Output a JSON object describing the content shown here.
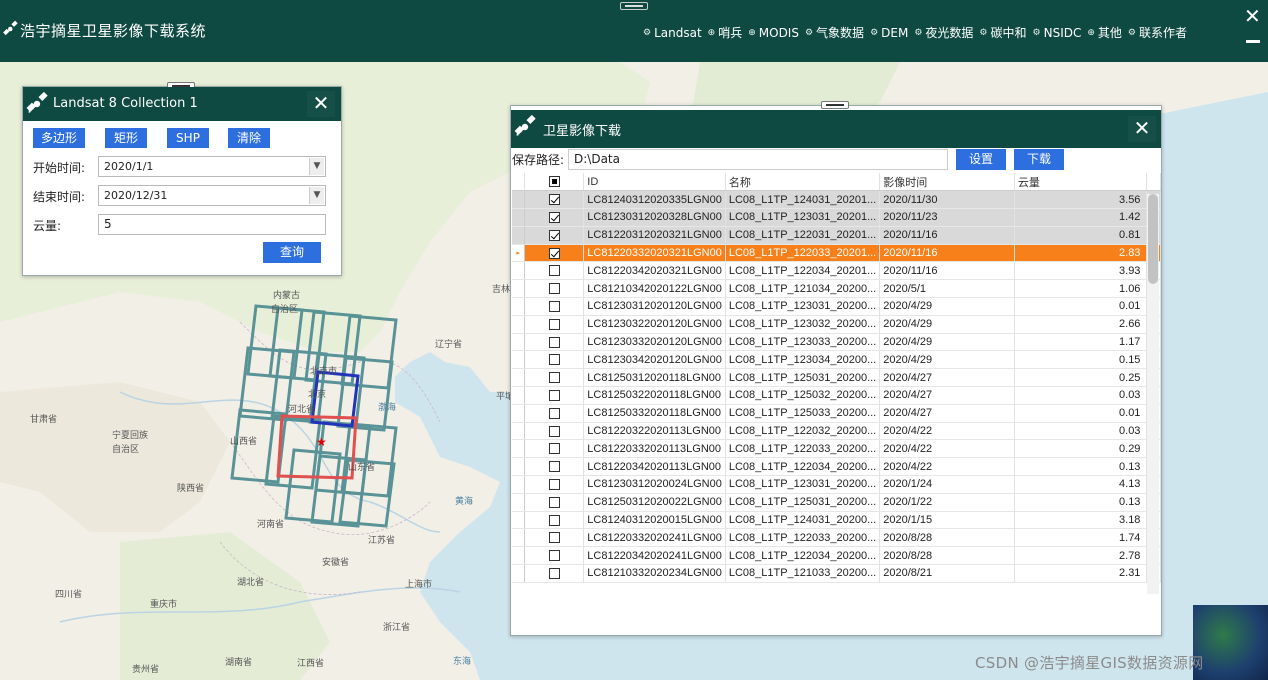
{
  "header": {
    "title": "浩宇摘星卫星影像下载系统",
    "nav": [
      {
        "label": "Landsat",
        "icon": "gear-icon"
      },
      {
        "label": "哨兵",
        "icon": "globe-icon"
      },
      {
        "label": "MODIS",
        "icon": "globe-icon"
      },
      {
        "label": "气象数据",
        "icon": "gear-icon"
      },
      {
        "label": "DEM",
        "icon": "gear-icon"
      },
      {
        "label": "夜光数据",
        "icon": "gear-icon"
      },
      {
        "label": "碳中和",
        "icon": "gear-icon"
      },
      {
        "label": "NSIDC",
        "icon": "gear-icon"
      },
      {
        "label": "其他",
        "icon": "globe-icon"
      },
      {
        "label": "联系作者",
        "icon": "gear-icon"
      }
    ]
  },
  "query": {
    "title": "Landsat 8 Collection 1",
    "buttons": [
      "多边形",
      "矩形",
      "SHP",
      "清除"
    ],
    "start_label": "开始时间:",
    "start_value": "2020/1/1",
    "end_label": "结束时间:",
    "end_value": "2020/12/31",
    "cloud_label": "云量:",
    "cloud_value": "5",
    "query_button": "查询"
  },
  "download": {
    "title": "卫星影像下载",
    "path_label": "保存路径:",
    "path_value": "D:\\Data",
    "set_button": "设置",
    "download_button": "下载",
    "columns": [
      "ID",
      "名称",
      "影像时间",
      "云量"
    ],
    "rows": [
      {
        "id": "LC81240312020335LGN00",
        "name": "LC08_L1TP_124031_20201...",
        "date": "2020/11/30",
        "cloud": "3.56",
        "checked": true,
        "state": "sel"
      },
      {
        "id": "LC81230312020328LGN00",
        "name": "LC08_L1TP_123031_20201...",
        "date": "2020/11/23",
        "cloud": "1.42",
        "checked": true,
        "state": "sel"
      },
      {
        "id": "LC81220312020321LGN00",
        "name": "LC08_L1TP_122031_20201...",
        "date": "2020/11/16",
        "cloud": "0.81",
        "checked": true,
        "state": "sel"
      },
      {
        "id": "LC81220332020321LGN00",
        "name": "LC08_L1TP_122033_20201...",
        "date": "2020/11/16",
        "cloud": "2.83",
        "checked": true,
        "state": "active"
      },
      {
        "id": "LC81220342020321LGN00",
        "name": "LC08_L1TP_122034_20201...",
        "date": "2020/11/16",
        "cloud": "3.93",
        "checked": false,
        "state": ""
      },
      {
        "id": "LC81210342020122LGN00",
        "name": "LC08_L1TP_121034_20200...",
        "date": "2020/5/1",
        "cloud": "1.06",
        "checked": false,
        "state": ""
      },
      {
        "id": "LC81230312020120LGN00",
        "name": "LC08_L1TP_123031_20200...",
        "date": "2020/4/29",
        "cloud": "0.01",
        "checked": false,
        "state": ""
      },
      {
        "id": "LC81230322020120LGN00",
        "name": "LC08_L1TP_123032_20200...",
        "date": "2020/4/29",
        "cloud": "2.66",
        "checked": false,
        "state": ""
      },
      {
        "id": "LC81230332020120LGN00",
        "name": "LC08_L1TP_123033_20200...",
        "date": "2020/4/29",
        "cloud": "1.17",
        "checked": false,
        "state": ""
      },
      {
        "id": "LC81230342020120LGN00",
        "name": "LC08_L1TP_123034_20200...",
        "date": "2020/4/29",
        "cloud": "0.15",
        "checked": false,
        "state": ""
      },
      {
        "id": "LC81250312020118LGN00",
        "name": "LC08_L1TP_125031_20200...",
        "date": "2020/4/27",
        "cloud": "0.25",
        "checked": false,
        "state": ""
      },
      {
        "id": "LC81250322020118LGN00",
        "name": "LC08_L1TP_125032_20200...",
        "date": "2020/4/27",
        "cloud": "0.03",
        "checked": false,
        "state": ""
      },
      {
        "id": "LC81250332020118LGN00",
        "name": "LC08_L1TP_125033_20200...",
        "date": "2020/4/27",
        "cloud": "0.01",
        "checked": false,
        "state": ""
      },
      {
        "id": "LC81220322020113LGN00",
        "name": "LC08_L1TP_122032_20200...",
        "date": "2020/4/22",
        "cloud": "0.03",
        "checked": false,
        "state": ""
      },
      {
        "id": "LC81220332020113LGN00",
        "name": "LC08_L1TP_122033_20200...",
        "date": "2020/4/22",
        "cloud": "0.29",
        "checked": false,
        "state": ""
      },
      {
        "id": "LC81220342020113LGN00",
        "name": "LC08_L1TP_122034_20200...",
        "date": "2020/4/22",
        "cloud": "0.13",
        "checked": false,
        "state": ""
      },
      {
        "id": "LC81230312020024LGN00",
        "name": "LC08_L1TP_123031_20200...",
        "date": "2020/1/24",
        "cloud": "4.13",
        "checked": false,
        "state": ""
      },
      {
        "id": "LC81250312020022LGN00",
        "name": "LC08_L1TP_125031_20200...",
        "date": "2020/1/22",
        "cloud": "0.13",
        "checked": false,
        "state": ""
      },
      {
        "id": "LC81240312020015LGN00",
        "name": "LC08_L1TP_124031_20200...",
        "date": "2020/1/15",
        "cloud": "3.18",
        "checked": false,
        "state": ""
      },
      {
        "id": "LC81220332020241LGN00",
        "name": "LC08_L1TP_122033_20200...",
        "date": "2020/8/28",
        "cloud": "1.74",
        "checked": false,
        "state": ""
      },
      {
        "id": "LC81220342020241LGN00",
        "name": "LC08_L1TP_122034_20200...",
        "date": "2020/8/28",
        "cloud": "2.78",
        "checked": false,
        "state": ""
      },
      {
        "id": "LC81210332020234LGN00",
        "name": "LC08_L1TP_121033_20200...",
        "date": "2020/8/21",
        "cloud": "2.31",
        "checked": false,
        "state": ""
      }
    ]
  },
  "map": {
    "labels": [
      {
        "text": "内蒙古",
        "cls": ""
      },
      {
        "text": "自治区",
        "cls": ""
      },
      {
        "text": "吉林",
        "cls": ""
      },
      {
        "text": "辽宁省",
        "cls": ""
      },
      {
        "text": "北京市",
        "cls": ""
      },
      {
        "text": "北京",
        "cls": ""
      },
      {
        "text": "河北省",
        "cls": ""
      },
      {
        "text": "渤海",
        "cls": "sea"
      },
      {
        "text": "平壤",
        "cls": ""
      },
      {
        "text": "甘肃省",
        "cls": ""
      },
      {
        "text": "宁夏回族",
        "cls": ""
      },
      {
        "text": "自治区",
        "cls": ""
      },
      {
        "text": "山西省",
        "cls": ""
      },
      {
        "text": "山东省",
        "cls": ""
      },
      {
        "text": "陕西省",
        "cls": ""
      },
      {
        "text": "黄海",
        "cls": "sea"
      },
      {
        "text": "河南省",
        "cls": ""
      },
      {
        "text": "江苏省",
        "cls": ""
      },
      {
        "text": "安徽省",
        "cls": ""
      },
      {
        "text": "湖北省",
        "cls": ""
      },
      {
        "text": "上海市",
        "cls": ""
      },
      {
        "text": "四川省",
        "cls": ""
      },
      {
        "text": "重庆市",
        "cls": ""
      },
      {
        "text": "浙江省",
        "cls": ""
      },
      {
        "text": "贵州省",
        "cls": ""
      },
      {
        "text": "湖南省",
        "cls": ""
      },
      {
        "text": "江西省",
        "cls": ""
      },
      {
        "text": "东海",
        "cls": "sea"
      }
    ]
  },
  "watermark": "CSDN @浩宇摘星GIS数据资源网",
  "colors": {
    "header_bg": "#0f4a42",
    "button_blue": "#2e6fe0",
    "active_row": "#f7801b",
    "footprint": "#4a8a8f",
    "highlight_blue": "#2233bb",
    "highlight_red": "#e05050"
  }
}
